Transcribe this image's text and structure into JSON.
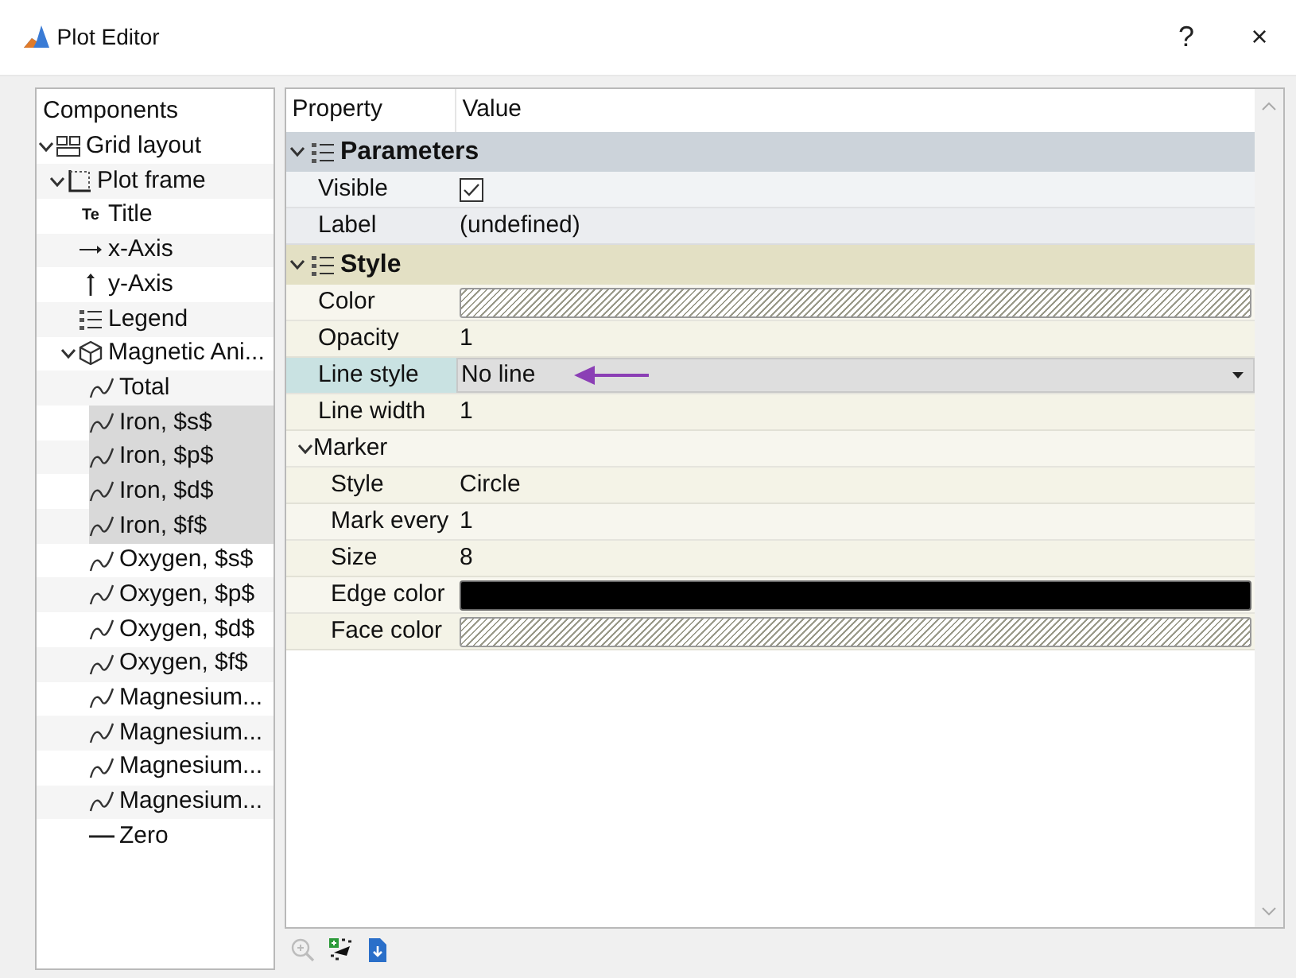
{
  "window": {
    "title": "Plot Editor",
    "help": "?",
    "close": "×"
  },
  "components": {
    "header": "Components",
    "items": [
      {
        "label": "Grid layout",
        "kind": "grid",
        "expanded": true,
        "selected": false,
        "children": [
          {
            "label": "Plot frame",
            "kind": "frame",
            "expanded": true,
            "selected": false,
            "children": [
              {
                "label": "Title",
                "kind": "title",
                "glyph": "Te",
                "selected": false
              },
              {
                "label": "x-Axis",
                "kind": "xaxis",
                "selected": false
              },
              {
                "label": "y-Axis",
                "kind": "yaxis",
                "selected": false
              },
              {
                "label": "Legend",
                "kind": "legend",
                "selected": false
              },
              {
                "label": "Magnetic Ani...",
                "kind": "cube",
                "expanded": true,
                "selected": false,
                "children": [
                  {
                    "label": "Total",
                    "kind": "curve",
                    "selected": false
                  },
                  {
                    "label": "Iron, $s$",
                    "kind": "curve",
                    "selected": true
                  },
                  {
                    "label": "Iron, $p$",
                    "kind": "curve",
                    "selected": true
                  },
                  {
                    "label": "Iron, $d$",
                    "kind": "curve",
                    "selected": true
                  },
                  {
                    "label": "Iron, $f$",
                    "kind": "curve",
                    "selected": true
                  },
                  {
                    "label": "Oxygen, $s$",
                    "kind": "curve",
                    "selected": false
                  },
                  {
                    "label": "Oxygen, $p$",
                    "kind": "curve",
                    "selected": false
                  },
                  {
                    "label": "Oxygen, $d$",
                    "kind": "curve",
                    "selected": false
                  },
                  {
                    "label": "Oxygen, $f$",
                    "kind": "curve",
                    "selected": false
                  },
                  {
                    "label": "Magnesium...",
                    "kind": "curve",
                    "selected": false
                  },
                  {
                    "label": "Magnesium...",
                    "kind": "curve",
                    "selected": false
                  },
                  {
                    "label": "Magnesium...",
                    "kind": "curve",
                    "selected": false
                  },
                  {
                    "label": "Magnesium...",
                    "kind": "curve",
                    "selected": false
                  },
                  {
                    "label": "Zero",
                    "kind": "line",
                    "selected": false
                  }
                ]
              }
            ]
          }
        ]
      }
    ]
  },
  "properties": {
    "columns": [
      "Property",
      "Value"
    ],
    "groups": [
      {
        "label": "Parameters",
        "color": "#ccd3da",
        "expanded": true,
        "rows": [
          {
            "kind": "check",
            "label": "Visible",
            "checked": true
          },
          {
            "kind": "text",
            "label": "Label",
            "value": "(undefined)"
          }
        ]
      },
      {
        "label": "Style",
        "color": "#e3e0c4",
        "expanded": true,
        "rows": [
          {
            "kind": "empty_swatch",
            "label": "Color"
          },
          {
            "kind": "text",
            "label": "Opacity",
            "value": "1"
          },
          {
            "kind": "dropdown",
            "label": "Line style",
            "value": "No line",
            "selected": true,
            "annotated": true
          },
          {
            "kind": "text",
            "label": "Line width",
            "value": "1"
          },
          {
            "kind": "subgroup",
            "label": "Marker",
            "expanded": true,
            "rows": [
              {
                "kind": "text",
                "label": "Style",
                "value": "Circle"
              },
              {
                "kind": "text",
                "label": "Mark every",
                "value": "1"
              },
              {
                "kind": "text",
                "label": "Size",
                "value": "8"
              },
              {
                "kind": "swatch",
                "label": "Edge color",
                "color": "#000000"
              },
              {
                "kind": "empty_swatch",
                "label": "Face color"
              }
            ]
          }
        ]
      }
    ]
  },
  "toolbar": [
    {
      "kind": "zoom",
      "disabled": true
    },
    {
      "kind": "add",
      "disabled": false
    },
    {
      "kind": "export",
      "disabled": false
    }
  ]
}
